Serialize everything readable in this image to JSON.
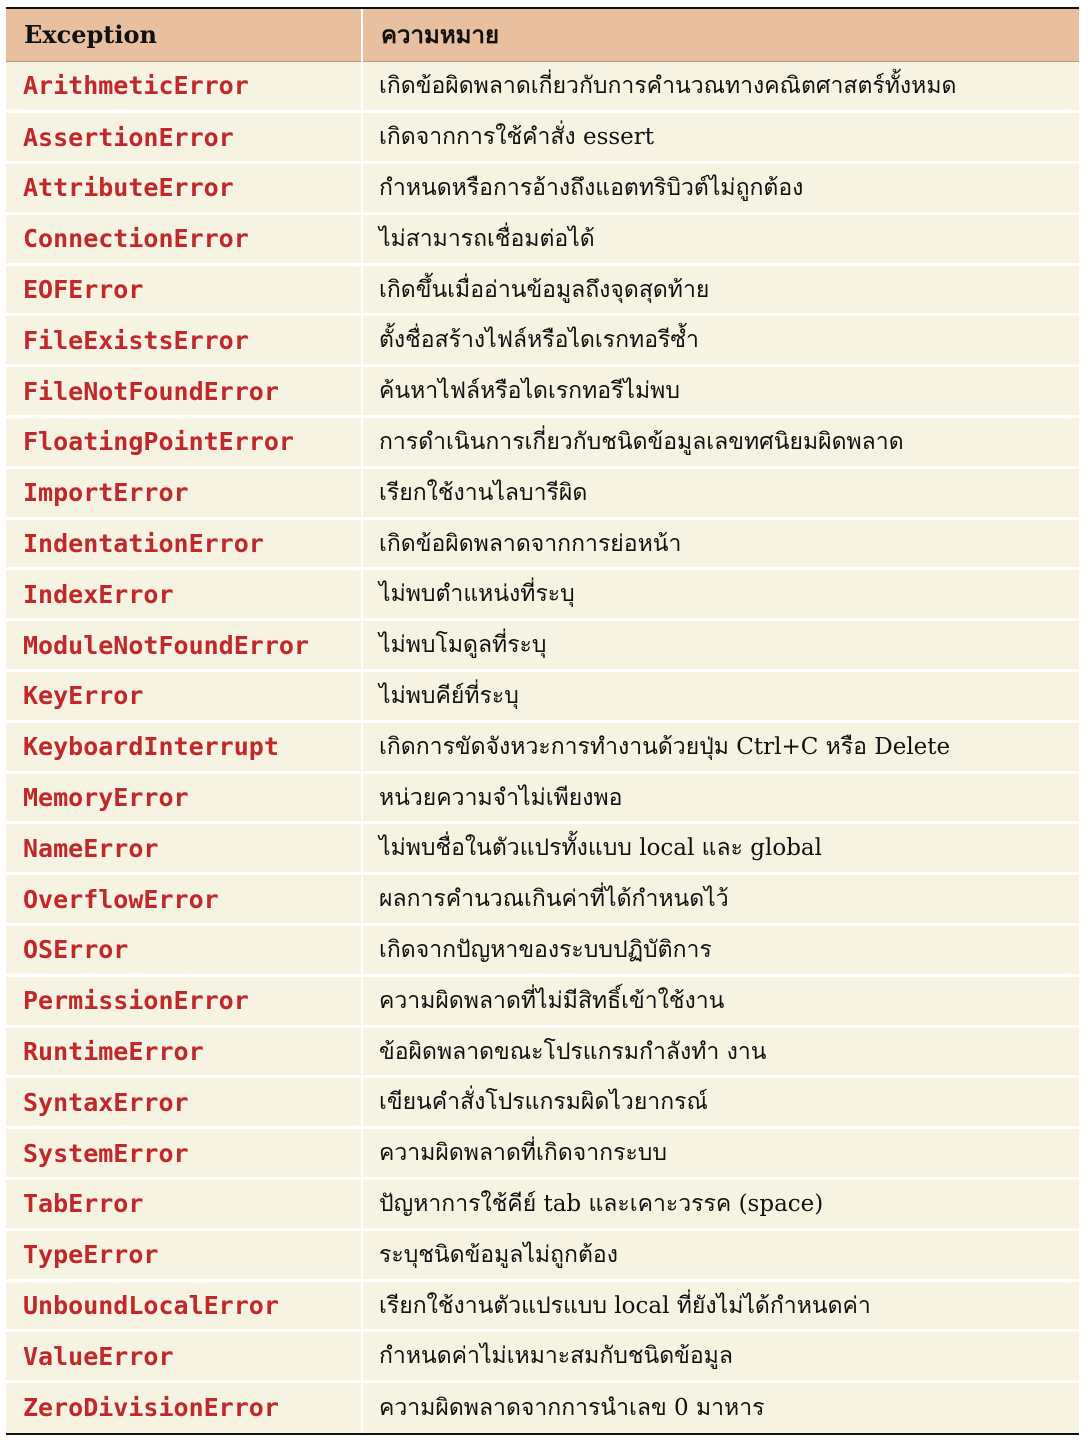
{
  "table": {
    "headers": [
      "Exception",
      "ความหมาย"
    ],
    "rows": [
      {
        "exception": "ArithmeticError",
        "meaning": "เกิดข้อผิดพลาดเกี่ยวกับการคำนวณทางคณิตศาสตร์ทั้งหมด"
      },
      {
        "exception": "AssertionError",
        "meaning": "เกิดจากการใช้คำสั่ง essert"
      },
      {
        "exception": "AttributeError",
        "meaning": "กำหนดหรือการอ้างถึงแอตทริบิวต์ไม่ถูกต้อง"
      },
      {
        "exception": "ConnectionError",
        "meaning": "ไม่สามารถเชื่อมต่อได้"
      },
      {
        "exception": "EOFError",
        "meaning": "เกิดขึ้นเมื่ออ่านข้อมูลถึงจุดสุดท้าย"
      },
      {
        "exception": "FileExistsError",
        "meaning": "ตั้งชื่อสร้างไฟล์หรือไดเรกทอรีซ้ำ"
      },
      {
        "exception": "FileNotFoundError",
        "meaning": "ค้นหาไฟล์หรือไดเรกทอรีไม่พบ"
      },
      {
        "exception": "FloatingPointError",
        "meaning": "การดำเนินการเกี่ยวกับชนิดข้อมูลเลขทศนิยมผิดพลาด"
      },
      {
        "exception": "ImportError",
        "meaning": "เรียกใช้งานไลบารีผิด"
      },
      {
        "exception": "IndentationError",
        "meaning": "เกิดข้อผิดพลาดจากการย่อหน้า"
      },
      {
        "exception": "IndexError",
        "meaning": "ไม่พบตำแหน่งที่ระบุ"
      },
      {
        "exception": "ModuleNotFoundError",
        "meaning": "ไม่พบโมดูลที่ระบุ"
      },
      {
        "exception": "KeyError",
        "meaning": "ไม่พบคีย์ที่ระบุ"
      },
      {
        "exception": "KeyboardInterrupt",
        "meaning": "เกิดการขัดจังหวะการทำงานด้วยปุ่ม Ctrl+C หรือ Delete"
      },
      {
        "exception": "MemoryError",
        "meaning": "หน่วยความจำไม่เพียงพอ"
      },
      {
        "exception": "NameError",
        "meaning": "ไม่พบชื่อในตัวแปรทั้งแบบ local และ global"
      },
      {
        "exception": "OverflowError",
        "meaning": "ผลการคำนวณเกินค่าที่ได้กำหนดไว้"
      },
      {
        "exception": "OSError",
        "meaning": "เกิดจากปัญหาของระบบปฏิบัติการ"
      },
      {
        "exception": "PermissionError",
        "meaning": "ความผิดพลาดที่ไม่มีสิทธิ์เข้าใช้งาน"
      },
      {
        "exception": "RuntimeError",
        "meaning": "ข้อผิดพลาดขณะโปรแกรมกำลังทำ งาน"
      },
      {
        "exception": "SyntaxError",
        "meaning": "เขียนคำสั่งโปรแกรมผิดไวยากรณ์"
      },
      {
        "exception": "SystemError",
        "meaning": "ความผิดพลาดที่เกิดจากระบบ"
      },
      {
        "exception": "TabError",
        "meaning": "ปัญหาการใช้คีย์ tab และเคาะวรรค (space)"
      },
      {
        "exception": "TypeError",
        "meaning": "ระบุชนิดข้อมูลไม่ถูกต้อง"
      },
      {
        "exception": "UnboundLocalError",
        "meaning": "เรียกใช้งานตัวแปรแบบ local ที่ยังไม่ได้กำหนดค่า"
      },
      {
        "exception": "ValueError",
        "meaning": "กำหนดค่าไม่เหมาะสมกับชนิดข้อมูล"
      },
      {
        "exception": "ZeroDivisionError",
        "meaning": "ความผิดพลาดจากการนำเลข 0 มาหาร"
      }
    ]
  },
  "colors": {
    "header_bg": "#e8bf9f",
    "row_bg": "#f7f3e3",
    "exception_text": "#c0282a"
  }
}
